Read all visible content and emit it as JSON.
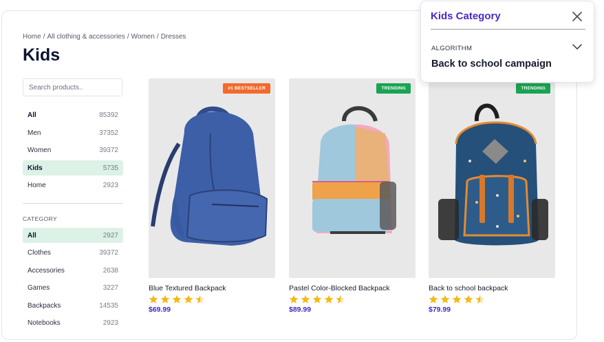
{
  "breadcrumb": [
    "Home",
    "All clothing & accessories",
    "Women",
    "Dresses"
  ],
  "page_title": "Kids",
  "search": {
    "placeholder": "Search products.."
  },
  "departments": [
    {
      "label": "All",
      "count": "85392"
    },
    {
      "label": "Men",
      "count": "37352"
    },
    {
      "label": "Women",
      "count": "39372"
    },
    {
      "label": "Kids",
      "count": "5735"
    },
    {
      "label": "Home",
      "count": "2923"
    }
  ],
  "category": {
    "heading": "CATEGORY",
    "items": [
      {
        "label": "All",
        "count": "2927"
      },
      {
        "label": "Clothes",
        "count": "39372"
      },
      {
        "label": "Accessories",
        "count": "2638"
      },
      {
        "label": "Games",
        "count": "3227"
      },
      {
        "label": "Backpacks",
        "count": "14535"
      },
      {
        "label": "Notebooks",
        "count": "2923"
      }
    ]
  },
  "products": [
    {
      "name": "Blue Textured Backpack",
      "price": "$69.99",
      "badge": "#1 BESTSELLER",
      "badge_color": "#f26a2b",
      "rating": 4.5,
      "image": "blue-textured-backpack-photo"
    },
    {
      "name": "Pastel Color-Blocked Backpack",
      "price": "$89.99",
      "badge": "TRENDING",
      "badge_color": "#1aa354",
      "rating": 4.5,
      "image": "pastel-backpack-photo"
    },
    {
      "name": "Back to school backpack",
      "price": "$79.99",
      "badge": "TRENDING",
      "badge_color": "#1aa354",
      "rating": 4.5,
      "image": "navy-patterned-backpack-photo"
    }
  ],
  "popup": {
    "title": "Kids Category",
    "field_label": "ALGORITHM",
    "value": "Back to school campaign",
    "close_icon": "close-icon",
    "expand_icon": "chevron-down-icon"
  },
  "colors": {
    "accent": "#4a28c8",
    "price": "#3d2bbf",
    "selected_bg": "#dcf2e6",
    "star": "#f5b914"
  }
}
